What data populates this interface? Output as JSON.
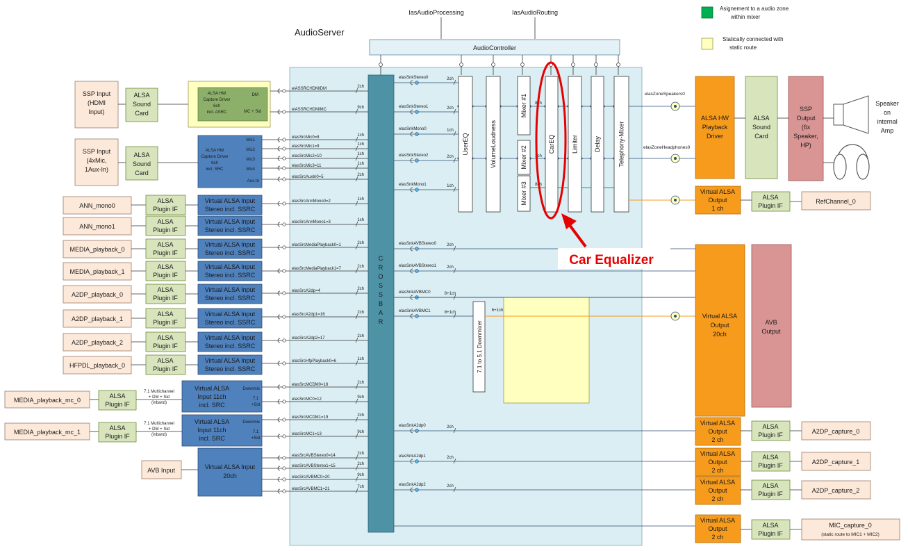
{
  "top_labels": {
    "ias_processing": "IasAudioProcessing",
    "ias_routing": "IasAudioRouting",
    "audio_server": "AudioServer",
    "audio_controller": "AudioController"
  },
  "legend": {
    "green_text_1": "Asignement to a audio zone",
    "green_text_2": "within mixer",
    "yellow_text_1": "Statically connected with",
    "yellow_text_2": "static route",
    "green_color": "#00b050",
    "yellow_color": "#ffffc0"
  },
  "crossbar_label": "CROSSBAR",
  "inputs": {
    "ssp_hdmi": [
      "SSP Input",
      "(HDMI",
      "Input)"
    ],
    "ssp_mic": [
      "SSP Input",
      "(4xMic,",
      "1Aux-In)"
    ],
    "alsa_sound_card": [
      "ALSA",
      "Sound",
      "Card"
    ],
    "hw_capture_1": [
      "ALSA HW",
      "Capture Driver",
      "6ch",
      "incl. ASRC"
    ],
    "hw_capture_1_ports": [
      "DM",
      "MC + Sid"
    ],
    "hw_capture_2": [
      "ALSA HW",
      "Capture Driver",
      "6ch",
      "incl. SRC"
    ],
    "hw_capture_2_ports": [
      "Mic1",
      "Mic2",
      "Mic3",
      "Mic4",
      "Aux-In"
    ],
    "sources": [
      "ANN_mono0",
      "ANN_mono1",
      "MEDIA_playback_0",
      "MEDIA_playback_1",
      "A2DP_playback_0",
      "A2DP_playback_1",
      "A2DP_playback_2",
      "HFPDL_playback_0"
    ],
    "plugin_if": [
      "ALSA",
      "Plugin IF"
    ],
    "virtual_stereo": [
      "Virtual ALSA Input",
      "Stereo incl. SSRC"
    ],
    "mc_sources": [
      "MEDIA_playback_mc_0",
      "MEDIA_playback_mc_1"
    ],
    "mc_note": [
      "7.1 Multichannel",
      "+ DM + Sid",
      "(inband)"
    ],
    "virtual_mc": [
      "Virtual ALSA",
      "Input 11ch",
      "incl. SRC"
    ],
    "mc_ports": [
      "Downmix",
      "7.1",
      "+Sid"
    ],
    "avb_input": "AVB Input",
    "virtual_avb": [
      "Virtual ALSA Input",
      "20ch"
    ]
  },
  "src_ports": [
    {
      "name": "eiASSRCHDMIDM",
      "ch": "2ch"
    },
    {
      "name": "eiASSRCHDMIMC",
      "ch": "9ch"
    },
    {
      "name": "elasSrcMic0=8",
      "ch": "1ch"
    },
    {
      "name": "elasSrcMic1=9",
      "ch": "1ch"
    },
    {
      "name": "elasSrcMic2=10",
      "ch": "1ch"
    },
    {
      "name": "elasSrcMic3=11",
      "ch": "1ch"
    },
    {
      "name": "elasSrcAuxIn0=5",
      "ch": "2ch"
    },
    {
      "name": "elasSrcAnnMono0=2",
      "ch": "1ch"
    },
    {
      "name": "elasSrcAnnMono1=3",
      "ch": "1ch"
    },
    {
      "name": "elasSrcMediaPlayback0=1",
      "ch": "2ch"
    },
    {
      "name": "elasSrcMediaPlayback1=7",
      "ch": "2ch"
    },
    {
      "name": "elasSrcA2dp=4",
      "ch": "2ch"
    },
    {
      "name": "elasSrcA2dp1=16",
      "ch": "2ch"
    },
    {
      "name": "elasSrcA2dp2=17",
      "ch": "2ch"
    },
    {
      "name": "elasSrcHfpPlayback0=6",
      "ch": "1ch"
    },
    {
      "name": "elasSrcMCDM0=18",
      "ch": "2ch"
    },
    {
      "name": "elasSrcMC0=12",
      "ch": "9ch"
    },
    {
      "name": "elasSrcMCDM1=19",
      "ch": "2ch"
    },
    {
      "name": "elasSrcMC1=13",
      "ch": "9ch"
    },
    {
      "name": "elasSrcAVBStereo0=14",
      "ch": "2ch"
    },
    {
      "name": "elasSrcAVBStereo1=15",
      "ch": "2ch"
    },
    {
      "name": "elasSrcAVBMC0=20",
      "ch": "9ch"
    },
    {
      "name": "elasSrcAVBMC1=21",
      "ch": "7ch"
    }
  ],
  "sink_ports": [
    {
      "name": "elasSnkStereo0",
      "ch": "2ch"
    },
    {
      "name": "elasSnkStereo1",
      "ch": "2ch"
    },
    {
      "name": "elasSnkMono0",
      "ch": "1ch"
    },
    {
      "name": "elasSnkStereo2",
      "ch": "2ch"
    },
    {
      "name": "elasSnkMono1",
      "ch": "1ch"
    },
    {
      "name": "elasSnkAVBStereo0",
      "ch": "2ch"
    },
    {
      "name": "elasSnkAVBStereo1",
      "ch": "2ch"
    },
    {
      "name": "elasSnkAVBMC0",
      "ch": "8+1ch"
    },
    {
      "name": "elasSnkAVBMC1",
      "ch": "8+1ch"
    },
    {
      "name": "elasSnkA2dp0",
      "ch": "2ch"
    },
    {
      "name": "elasSnkA2dp1",
      "ch": "2ch"
    },
    {
      "name": "elasSnkA2dp2",
      "ch": "2ch"
    }
  ],
  "processing": [
    "UserEQ",
    "VolumeLoudness",
    "Mixer #1",
    "Mixer #2",
    "Mixer #3",
    "CarEQ",
    "Limiter",
    "Delay",
    "Telephony-Mixer"
  ],
  "proc_ch": [
    "8ch",
    "2ch",
    "8ch"
  ],
  "downmixer": "7.1 to 5.1 Downmixer",
  "downmix_ch": "6+1ch",
  "zones": {
    "speakers": "elasZoneSpeakers0",
    "headphones": "elasZoneHeadphones0"
  },
  "outputs": {
    "hw_playback": [
      "ALSA HW",
      "Playback",
      "Driver"
    ],
    "alsa_sound_card": [
      "ALSA",
      "Sound",
      "Card"
    ],
    "ssp_output": [
      "SSP",
      "Output",
      "(6x",
      "Speaker,",
      "HP)"
    ],
    "speaker_note": [
      "Speaker",
      "on",
      "internal",
      "Amp"
    ],
    "virtual_1ch": [
      "Virtual ALSA",
      "Output",
      "1 ch"
    ],
    "ref_channel": "RefChannel_0",
    "virtual_20ch": [
      "Virtual ALSA",
      "Output",
      "20ch"
    ],
    "avb_output": [
      "AVB",
      "Output"
    ],
    "virtual_2ch": [
      "Virtual ALSA",
      "Output",
      "2 ch"
    ],
    "capture": [
      "A2DP_capture_0",
      "A2DP_capture_1",
      "A2DP_capture_2"
    ],
    "mic_capture": [
      "MIC_capture_0",
      "(static route to MIC1 + MIC2)"
    ]
  },
  "annotation": {
    "text": "Car Equalizer",
    "color": "#e60000"
  }
}
